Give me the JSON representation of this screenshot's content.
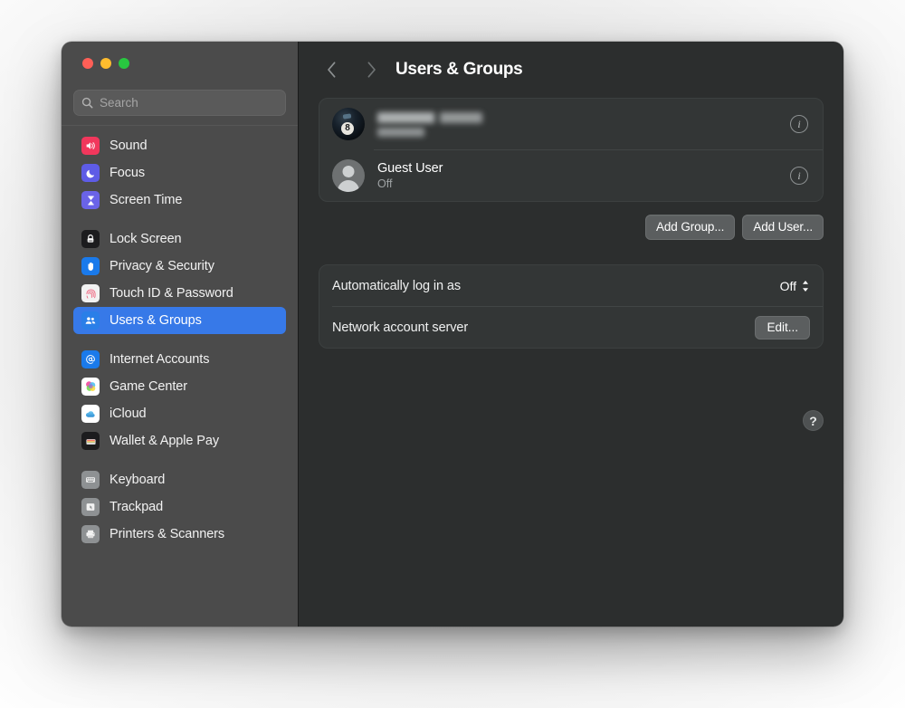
{
  "window": {
    "traffic_lights": [
      "close",
      "minimize",
      "maximize"
    ],
    "colors": {
      "sidebar_bg": "#4b4b4b",
      "content_bg": "#2c2e2e",
      "panel_bg": "#333636",
      "accent": "#3779e8"
    }
  },
  "sidebar": {
    "search": {
      "placeholder": "Search",
      "value": ""
    },
    "groups": [
      {
        "items": [
          {
            "label": "Sound",
            "icon": "speaker-icon"
          },
          {
            "label": "Focus",
            "icon": "moon-icon"
          },
          {
            "label": "Screen Time",
            "icon": "hourglass-icon"
          }
        ]
      },
      {
        "items": [
          {
            "label": "Lock Screen",
            "icon": "lock-icon"
          },
          {
            "label": "Privacy & Security",
            "icon": "hand-icon"
          },
          {
            "label": "Touch ID & Password",
            "icon": "fingerprint-icon"
          },
          {
            "label": "Users & Groups",
            "icon": "users-icon",
            "selected": true
          }
        ]
      },
      {
        "items": [
          {
            "label": "Internet Accounts",
            "icon": "at-sign-icon"
          },
          {
            "label": "Game Center",
            "icon": "game-center-icon"
          },
          {
            "label": "iCloud",
            "icon": "cloud-icon"
          },
          {
            "label": "Wallet & Apple Pay",
            "icon": "wallet-icon"
          }
        ]
      },
      {
        "items": [
          {
            "label": "Keyboard",
            "icon": "keyboard-icon"
          },
          {
            "label": "Trackpad",
            "icon": "trackpad-icon"
          },
          {
            "label": "Printers & Scanners",
            "icon": "printer-icon"
          }
        ]
      }
    ]
  },
  "header": {
    "back": "‹",
    "forward": "›",
    "title": "Users & Groups"
  },
  "users": [
    {
      "name": "",
      "name_redacted": true,
      "subtitle": "",
      "avatar": "eight-ball-avatar",
      "info_label": "i"
    },
    {
      "name": "Guest User",
      "name_redacted": false,
      "subtitle": "Off",
      "avatar": "guest-avatar",
      "info_label": "i"
    }
  ],
  "actions": {
    "add_group": "Add Group...",
    "add_user": "Add User..."
  },
  "settings": [
    {
      "label": "Automatically log in as",
      "control": "popup",
      "value": "Off"
    },
    {
      "label": "Network account server",
      "control": "button",
      "value": "Edit..."
    }
  ],
  "help": {
    "label": "?"
  }
}
